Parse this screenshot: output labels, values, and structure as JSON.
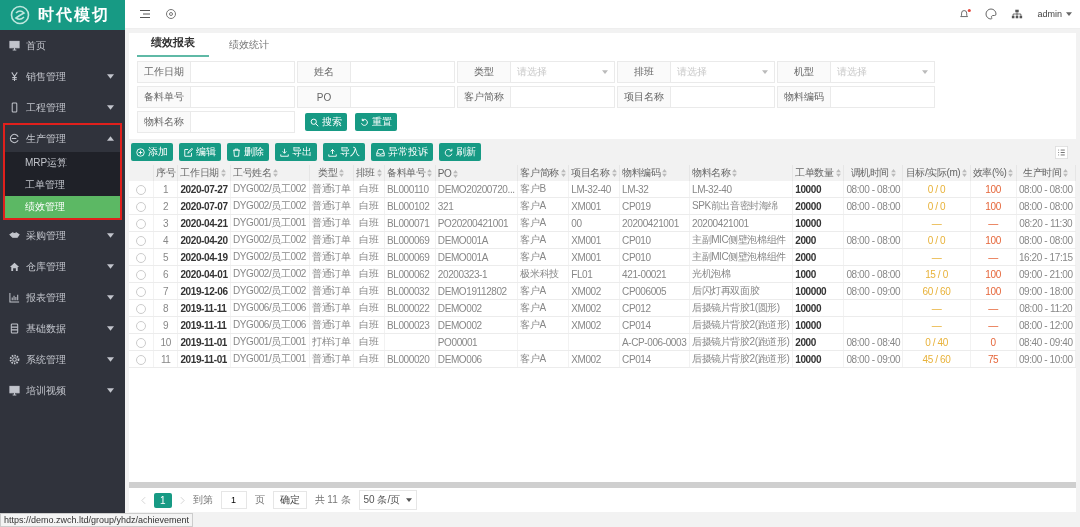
{
  "logo": {
    "text": "时代模切"
  },
  "topbar": {
    "user": "admin"
  },
  "sidebar": {
    "items": [
      {
        "label": "首页",
        "kind": "link",
        "highlighted": false
      },
      {
        "label": "销售管理",
        "kind": "group",
        "expanded": false,
        "highlighted": false
      },
      {
        "label": "工程管理",
        "kind": "group",
        "expanded": false,
        "highlighted": false
      },
      {
        "label": "生产管理",
        "kind": "group",
        "expanded": true,
        "highlighted": true,
        "children": [
          {
            "label": "MRP运算",
            "selected": false
          },
          {
            "label": "工单管理",
            "selected": false
          },
          {
            "label": "绩效管理",
            "selected": true
          }
        ]
      },
      {
        "label": "采购管理",
        "kind": "group",
        "expanded": false,
        "highlighted": false
      },
      {
        "label": "仓库管理",
        "kind": "group",
        "expanded": false,
        "highlighted": false
      },
      {
        "label": "报表管理",
        "kind": "group",
        "expanded": false,
        "highlighted": false
      },
      {
        "label": "基础数据",
        "kind": "group",
        "expanded": false,
        "highlighted": false
      },
      {
        "label": "系统管理",
        "kind": "group",
        "expanded": false,
        "highlighted": false
      },
      {
        "label": "培训视频",
        "kind": "group",
        "expanded": false,
        "highlighted": false
      }
    ]
  },
  "tabs": [
    {
      "label": "绩效报表",
      "selected": true
    },
    {
      "label": "绩效统计",
      "selected": false
    }
  ],
  "filters": [
    {
      "label": "工作日期",
      "kind": "input"
    },
    {
      "label": "姓名",
      "kind": "input"
    },
    {
      "label": "类型",
      "kind": "select",
      "placeholder": "请选择"
    },
    {
      "label": "排班",
      "kind": "select",
      "placeholder": "请选择"
    },
    {
      "label": "机型",
      "kind": "select",
      "placeholder": "请选择"
    },
    {
      "label": "备料单号",
      "kind": "input"
    },
    {
      "label": "PO",
      "kind": "input"
    },
    {
      "label": "客户简称",
      "kind": "input"
    },
    {
      "label": "项目名称",
      "kind": "input"
    },
    {
      "label": "物料编码",
      "kind": "input"
    },
    {
      "label": "物料名称",
      "kind": "input"
    }
  ],
  "filter_buttons": [
    "搜索",
    "重置"
  ],
  "toolbar": [
    "添加",
    "编辑",
    "删除",
    "导出",
    "导入",
    "异常投诉",
    "刷新"
  ],
  "table": {
    "columns": [
      {
        "label": "序号",
        "kind": "index",
        "sortable": false
      },
      {
        "label": "工作日期",
        "kind": "bold",
        "sortable": true
      },
      {
        "label": "工号姓名",
        "kind": "text",
        "sortable": true
      },
      {
        "label": "类型",
        "kind": "center",
        "sortable": true
      },
      {
        "label": "排班",
        "kind": "center",
        "sortable": true
      },
      {
        "label": "备料单号",
        "kind": "text",
        "sortable": true
      },
      {
        "label": "PO",
        "kind": "text",
        "sortable": true
      },
      {
        "label": "客户简称",
        "kind": "text",
        "sortable": true
      },
      {
        "label": "项目名称",
        "kind": "text",
        "sortable": true
      },
      {
        "label": "物料编码",
        "kind": "text",
        "sortable": true
      },
      {
        "label": "物料名称",
        "kind": "text",
        "sortable": true
      },
      {
        "label": "工单数量",
        "kind": "bold",
        "sortable": true
      },
      {
        "label": "调机时间",
        "kind": "center",
        "sortable": true
      },
      {
        "label": "目标/实际(m)",
        "kind": "target",
        "sortable": true
      },
      {
        "label": "效率(%)",
        "kind": "efficiency",
        "sortable": true
      },
      {
        "label": "生产时间",
        "kind": "center",
        "sortable": true
      }
    ],
    "rows": [
      {
        "selected": false,
        "cells": [
          "1",
          "2020-07-27",
          "DYG002/员工002",
          "普通订单",
          "白班",
          "BL000110",
          "DEMO20200720...",
          "客户B",
          "LM-32-40",
          "LM-32",
          "LM-32-40",
          "10000",
          "08:00 - 08:00",
          "0 / 0",
          "100",
          "08:00 - 08:00"
        ]
      },
      {
        "selected": false,
        "cells": [
          "2",
          "2020-07-07",
          "DYG002/员工002",
          "普通订单",
          "白班",
          "BL000102",
          "321",
          "客户A",
          "XM001",
          "CP019",
          "SPK前出音密封海绵",
          "20000",
          "08:00 - 08:00",
          "0 / 0",
          "100",
          "08:00 - 08:00"
        ]
      },
      {
        "selected": false,
        "cells": [
          "3",
          "2020-04-21",
          "DYG001/员工001",
          "普通订单",
          "白班",
          "BL000071",
          "PO20200421001",
          "客户A",
          "00",
          "20200421001",
          "20200421001",
          "10000",
          null,
          "—",
          "—",
          "08:20 - 11:30"
        ]
      },
      {
        "selected": false,
        "cells": [
          "4",
          "2020-04-20",
          "DYG002/员工002",
          "普通订单",
          "白班",
          "BL000069",
          "DEMO001A",
          "客户A",
          "XM001",
          "CP010",
          "主副MIC侧壁泡棉组件",
          "2000",
          "08:00 - 08:00",
          "0 / 0",
          "100",
          "08:00 - 08:00"
        ]
      },
      {
        "selected": false,
        "cells": [
          "5",
          "2020-04-19",
          "DYG002/员工002",
          "普通订单",
          "白班",
          "BL000069",
          "DEMO001A",
          "客户A",
          "XM001",
          "CP010",
          "主副MIC侧壁泡棉组件",
          "2000",
          null,
          "—",
          "—",
          "16:20 - 17:15"
        ]
      },
      {
        "selected": false,
        "cells": [
          "6",
          "2020-04-01",
          "DYG002/员工002",
          "普通订单",
          "白班",
          "BL000062",
          "20200323-1",
          "极米科技",
          "FL01",
          "421-00021",
          "光机泡棉",
          "1000",
          "08:00 - 08:00",
          "15 / 0",
          "100",
          "09:00 - 21:00"
        ]
      },
      {
        "selected": false,
        "cells": [
          "7",
          "2019-12-06",
          "DYG002/员工002",
          "普通订单",
          "白班",
          "BL000032",
          "DEMO19112802",
          "客户A",
          "XM002",
          "CP006005",
          "后闪灯再双面胶",
          "100000",
          "08:00 - 09:00",
          "60 / 60",
          "100",
          "09:00 - 18:00"
        ]
      },
      {
        "selected": false,
        "cells": [
          "8",
          "2019-11-11",
          "DYG006/员工006",
          "普通订单",
          "白班",
          "BL000022",
          "DEMO002",
          "客户A",
          "XM002",
          "CP012",
          "后摄镜片背胶1(圆形)",
          "10000",
          null,
          "—",
          "—",
          "08:00 - 11:20"
        ]
      },
      {
        "selected": false,
        "cells": [
          "9",
          "2019-11-11",
          "DYG006/员工006",
          "普通订单",
          "白班",
          "BL000023",
          "DEMO002",
          "客户A",
          "XM002",
          "CP014",
          "后摄镜片背胶2(跑道形)",
          "10000",
          null,
          "—",
          "—",
          "08:00 - 12:00"
        ]
      },
      {
        "selected": false,
        "cells": [
          "10",
          "2019-11-01",
          "DYG001/员工001",
          "打样订单",
          "白班",
          null,
          "PO00001",
          null,
          null,
          "A-CP-006-0003",
          "后摄镜片背胶2(跑道形)",
          "2000",
          "08:00 - 08:40",
          "0 / 40",
          "0",
          "08:40 - 09:40"
        ]
      },
      {
        "selected": false,
        "cells": [
          "11",
          "2019-11-01",
          "DYG001/员工001",
          "普通订单",
          "白班",
          "BL000020",
          "DEMO006",
          "客户A",
          "XM002",
          "CP014",
          "后摄镜片背胶2(跑道形)",
          "10000",
          "08:00 - 09:00",
          "45 / 60",
          "75",
          "09:00 - 10:00"
        ]
      }
    ]
  },
  "pagination": {
    "pages": [
      {
        "label": "1",
        "selected": true
      }
    ],
    "goto_label": "到第",
    "goto_value": "1",
    "page_unit": "页",
    "confirm": "确定",
    "total": "共 11 条",
    "page_size": "50 条/页"
  },
  "status_url": "https://demo.zwch.ltd/group/yhdz/achievement"
}
